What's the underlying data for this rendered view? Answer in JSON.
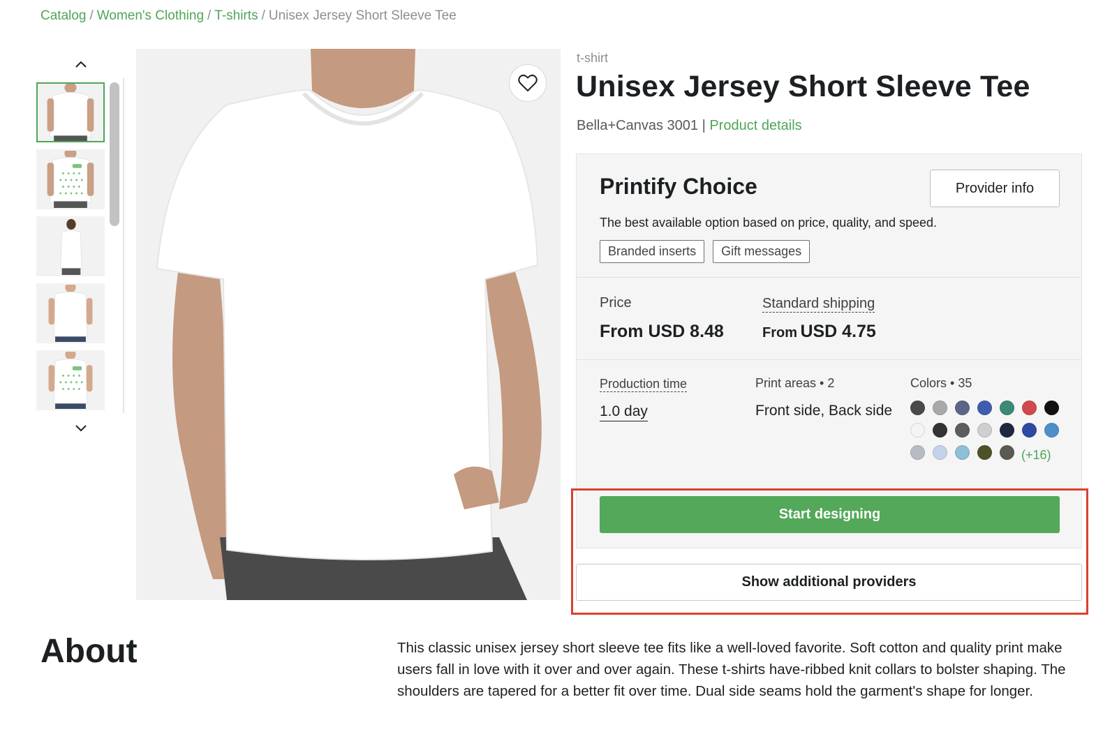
{
  "breadcrumb": {
    "items": [
      "Catalog",
      "Women's Clothing",
      "T-shirts"
    ],
    "separator": "/",
    "current": "Unisex Jersey Short Sleeve Tee"
  },
  "gallery": {
    "thumbnails": [
      {
        "name": "front-plain",
        "active": true
      },
      {
        "name": "front-pattern",
        "active": false
      },
      {
        "name": "side-view",
        "active": false
      },
      {
        "name": "female-front-plain",
        "active": false
      },
      {
        "name": "female-front-pattern",
        "active": false
      }
    ],
    "up_icon": "chevron-up-icon",
    "down_icon": "chevron-down-icon",
    "favorite_icon": "heart-icon"
  },
  "product": {
    "type": "t-shirt",
    "title": "Unisex Jersey Short Sleeve Tee",
    "brand_model": "Bella+Canvas 3001",
    "separator": "|",
    "details_link": "Product details"
  },
  "provider": {
    "name": "Printify Choice",
    "info_button": "Provider info",
    "description": "The best available option based on price, quality, and speed.",
    "tags": [
      "Branded inserts",
      "Gift messages"
    ],
    "price_label": "Price",
    "price_value": "From USD 8.48",
    "shipping_label": "Standard shipping",
    "shipping_from": "From",
    "shipping_amount": "USD 4.75",
    "production_label": "Production time",
    "production_value": "1.0 day",
    "print_areas_label": "Print areas • 2",
    "print_areas_value": "Front side, Back side",
    "colors_label": "Colors • 35",
    "colors": [
      "#4a4a4a",
      "#a9a9a9",
      "#5c6587",
      "#3f5cae",
      "#3b8a73",
      "#d2494b",
      "#111111",
      "#f4f4f4",
      "#333333",
      "#5b5d60",
      "#cfcfcf",
      "#1f2740",
      "#2e4aa0",
      "#4f8fc8",
      "#b7bcc4",
      "#c5d3ea",
      "#8dbfd6",
      "#4f5226",
      "#5a5a52"
    ],
    "more_colors": "(+16)",
    "start_button": "Start designing"
  },
  "additional_providers_button": "Show additional providers",
  "about": {
    "title": "About",
    "text": "This classic unisex jersey short sleeve tee fits like a well-loved favorite. Soft cotton and quality print make users fall in love with it over and over again. These t-shirts have-ribbed knit collars to bolster shaping. The shoulders are tapered for a better fit over time. Dual side seams hold the garment's shape for longer."
  },
  "theme": {
    "accent": "#53a85a",
    "link": "#4ea657",
    "highlight": "#d9412f"
  }
}
